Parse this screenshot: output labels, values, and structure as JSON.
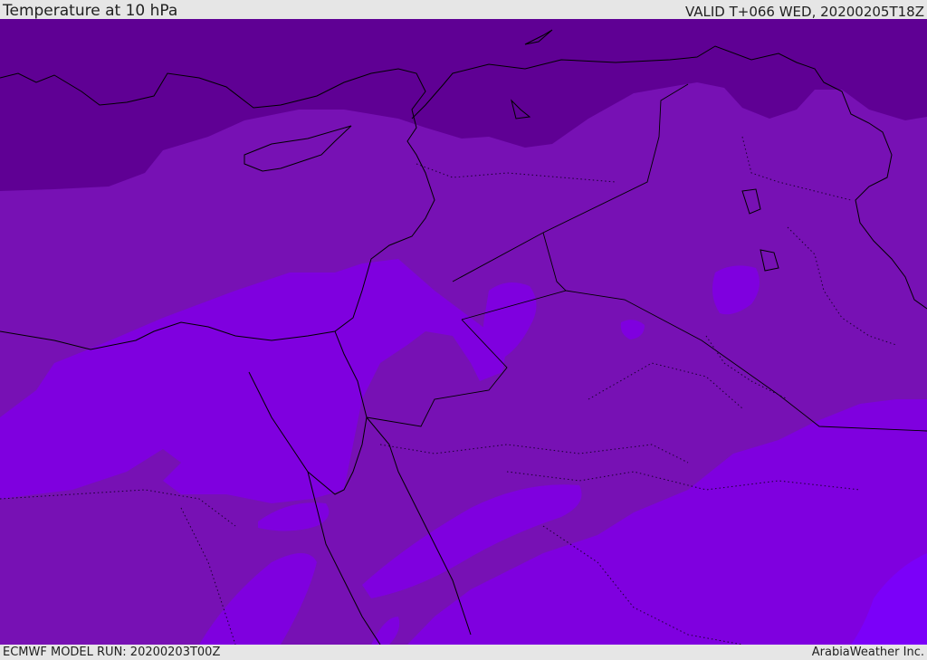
{
  "header": {
    "title": "Temperature at 10 hPa",
    "valid": "VALID T+066 WED, 20200205T18Z"
  },
  "footer": {
    "model_run": "ECMWF MODEL RUN: 20200203T00Z",
    "credit": "ArabiaWeather Inc."
  },
  "map": {
    "field": "Temperature at 10 hPa",
    "colors": {
      "coldest": "#5f0094",
      "cold": "#7711b4",
      "mid": "#7f00df",
      "warm": "#7b00f9",
      "coast": "#000000"
    }
  }
}
